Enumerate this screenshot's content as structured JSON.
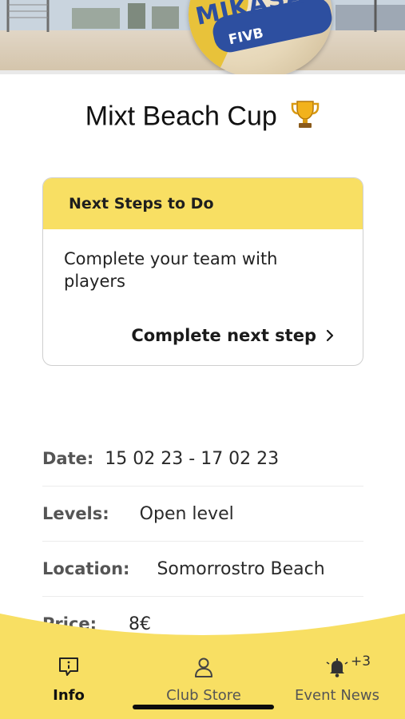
{
  "event": {
    "title": "Mixt Beach Cup",
    "title_icon": "trophy-icon"
  },
  "hero": {
    "ball_brand": "MIKASA",
    "ball_badge": "FIVB"
  },
  "next_steps": {
    "header": "Next Steps to Do",
    "body": "Complete your team with players",
    "action_label": "Complete next step",
    "action_icon": "chevron-right-icon"
  },
  "details": [
    {
      "label": "Date:",
      "value": "15 02 23 - 17 02 23"
    },
    {
      "label": "Levels:",
      "value": "Open level"
    },
    {
      "label": "Location:",
      "value": "Somorrostro Beach"
    },
    {
      "label": "Price:",
      "value": "8€"
    }
  ],
  "bottom_nav": {
    "items": [
      {
        "label": "Info",
        "icon": "info-bubble-icon",
        "active": true
      },
      {
        "label": "Club Store",
        "icon": "person-icon",
        "active": false
      },
      {
        "label": "Event News",
        "icon": "bell-icon",
        "active": false,
        "badge": "+3"
      }
    ]
  },
  "colors": {
    "accent_yellow": "#f8df63",
    "text_dark": "#1a1a1a",
    "label_gray": "#555555"
  }
}
